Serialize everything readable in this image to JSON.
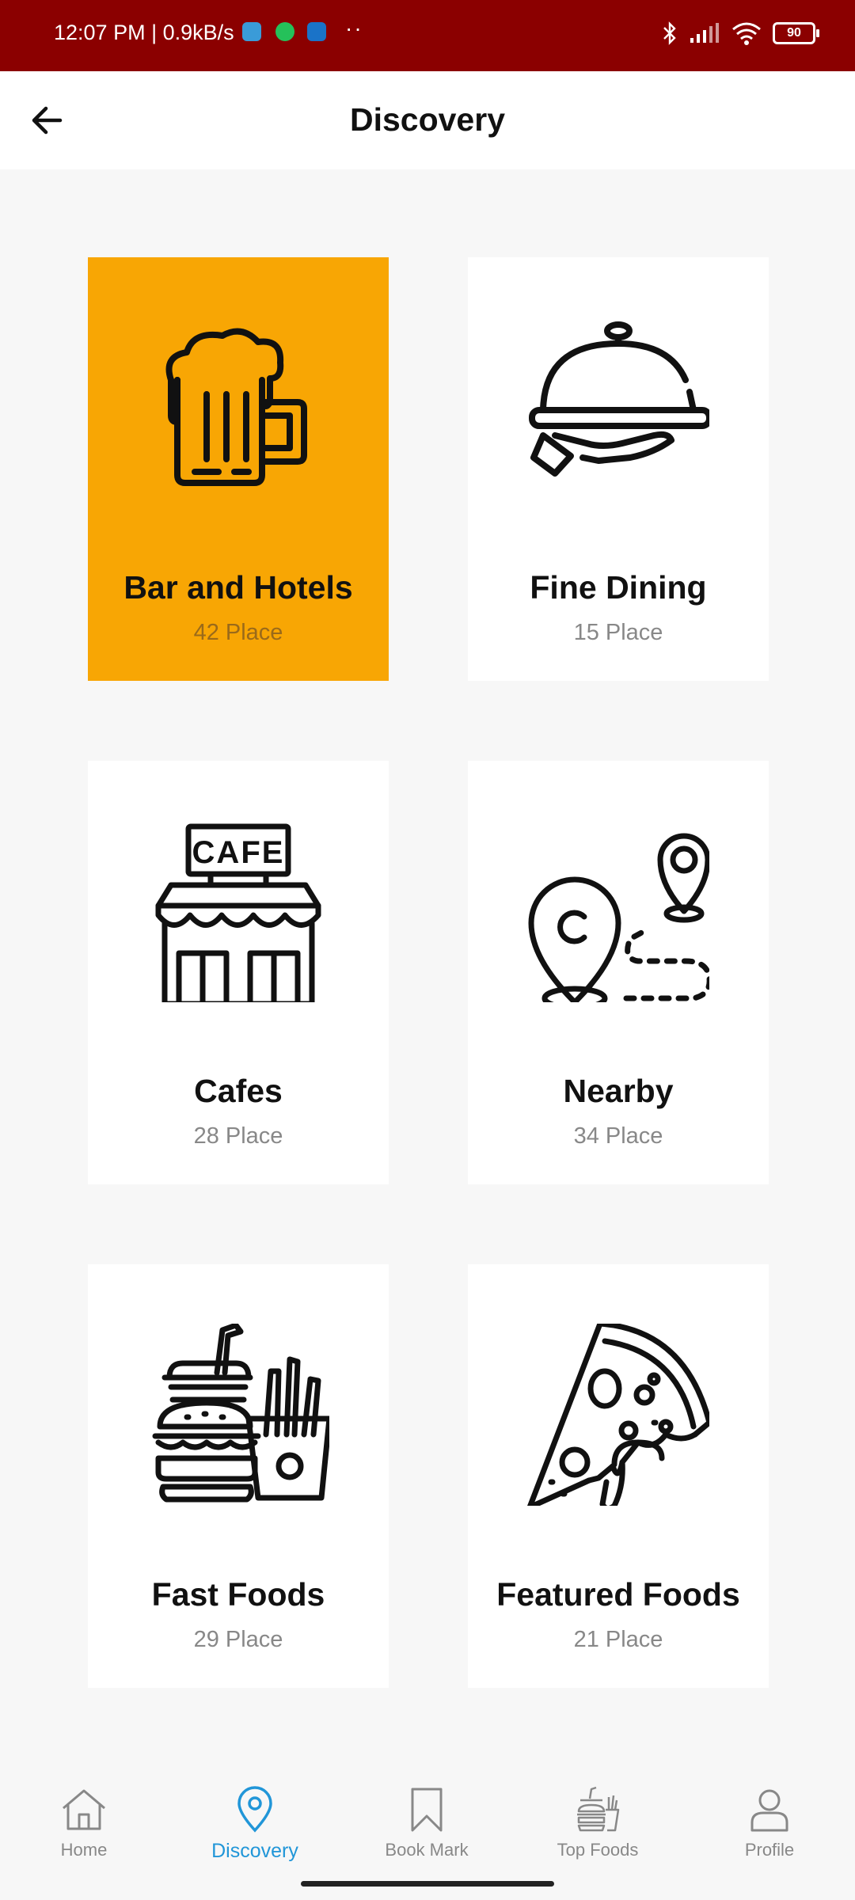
{
  "status_bar": {
    "time_speed": "12:07 PM | 0.9kB/s",
    "more": "··",
    "battery": "90"
  },
  "header": {
    "title": "Discovery",
    "back_icon": "arrow-left-icon"
  },
  "categories": [
    {
      "label": "Bar and Hotels",
      "count": "42 Place",
      "icon": "beer-mug-icon",
      "selected": true
    },
    {
      "label": "Fine Dining",
      "count": "15 Place",
      "icon": "cloche-icon",
      "selected": false
    },
    {
      "label": "Cafes",
      "count": "28 Place",
      "icon": "cafe-icon",
      "selected": false
    },
    {
      "label": "Nearby",
      "count": "34 Place",
      "icon": "map-route-icon",
      "selected": false
    },
    {
      "label": "Fast Foods",
      "count": "29 Place",
      "icon": "fast-food-icon",
      "selected": false
    },
    {
      "label": "Featured Foods",
      "count": "21 Place",
      "icon": "pizza-slice-icon",
      "selected": false
    }
  ],
  "bottom_nav": {
    "items": [
      {
        "label": "Home",
        "icon": "home-icon",
        "active": false
      },
      {
        "label": "Discovery",
        "icon": "location-pin-icon",
        "active": true
      },
      {
        "label": "Book Mark",
        "icon": "bookmark-icon",
        "active": false
      },
      {
        "label": "Top Foods",
        "icon": "food-icon",
        "active": false
      },
      {
        "label": "Profile",
        "icon": "user-icon",
        "active": false
      }
    ]
  },
  "colors": {
    "status_bar": "#8b0000",
    "selected_card": "#f8a604",
    "nav_active": "#2196d8",
    "nav_inactive": "#888888"
  }
}
